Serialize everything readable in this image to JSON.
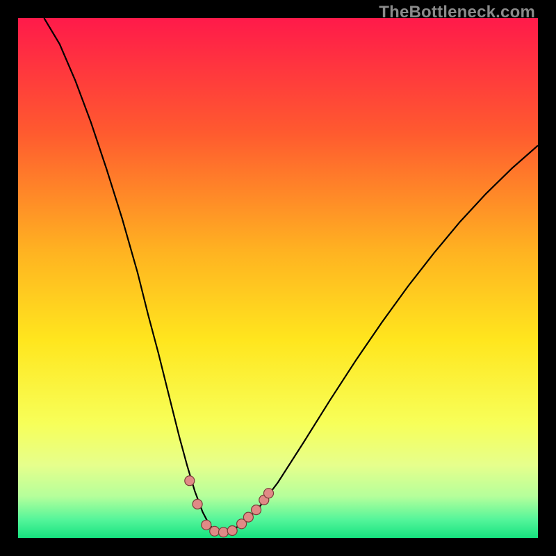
{
  "watermark": "TheBottleneck.com",
  "chart_data": {
    "type": "line",
    "title": "",
    "xlabel": "",
    "ylabel": "",
    "xlim": [
      0,
      100
    ],
    "ylim": [
      0,
      100
    ],
    "background_gradient": {
      "stops": [
        {
          "offset": 0.0,
          "color": "#FF1A4A"
        },
        {
          "offset": 0.22,
          "color": "#FF5A2F"
        },
        {
          "offset": 0.45,
          "color": "#FFB321"
        },
        {
          "offset": 0.62,
          "color": "#FFE61E"
        },
        {
          "offset": 0.78,
          "color": "#F7FF59"
        },
        {
          "offset": 0.86,
          "color": "#E6FF8C"
        },
        {
          "offset": 0.92,
          "color": "#B5FF9B"
        },
        {
          "offset": 0.965,
          "color": "#54F59A"
        },
        {
          "offset": 1.0,
          "color": "#16E27F"
        }
      ]
    },
    "series": [
      {
        "name": "bottleneck-curve",
        "color": "#000000",
        "stroke_width": 2.2,
        "x": [
          5,
          8,
          11,
          14,
          17,
          20,
          23,
          25,
          27,
          29,
          31,
          32.5,
          34,
          35.5,
          36.8,
          38,
          39,
          41,
          43,
          46,
          50,
          55,
          60,
          65,
          70,
          75,
          80,
          85,
          90,
          95,
          100
        ],
        "y": [
          100,
          95,
          88,
          80,
          71,
          61.5,
          51,
          43,
          35.5,
          27.5,
          19.5,
          14,
          9,
          5,
          2.5,
          1.2,
          1,
          1.3,
          2.7,
          5.4,
          10.7,
          18.5,
          26.5,
          34.2,
          41.5,
          48.4,
          54.8,
          60.8,
          66.2,
          71.1,
          75.5
        ]
      }
    ],
    "markers": [
      {
        "x": 33.0,
        "y": 11.0,
        "r": 7,
        "fill": "#e08a86",
        "stroke": "#7a3b38"
      },
      {
        "x": 34.5,
        "y": 6.5,
        "r": 7,
        "fill": "#e08a86",
        "stroke": "#7a3b38"
      },
      {
        "x": 36.2,
        "y": 2.5,
        "r": 7,
        "fill": "#e08a86",
        "stroke": "#7a3b38"
      },
      {
        "x": 37.8,
        "y": 1.3,
        "r": 7,
        "fill": "#e08a86",
        "stroke": "#7a3b38"
      },
      {
        "x": 39.5,
        "y": 1.1,
        "r": 7,
        "fill": "#e08a86",
        "stroke": "#7a3b38"
      },
      {
        "x": 41.2,
        "y": 1.4,
        "r": 7,
        "fill": "#e08a86",
        "stroke": "#7a3b38"
      },
      {
        "x": 43.0,
        "y": 2.7,
        "r": 7,
        "fill": "#e08a86",
        "stroke": "#7a3b38"
      },
      {
        "x": 44.3,
        "y": 4.0,
        "r": 7,
        "fill": "#e08a86",
        "stroke": "#7a3b38"
      },
      {
        "x": 45.8,
        "y": 5.4,
        "r": 7,
        "fill": "#e08a86",
        "stroke": "#7a3b38"
      },
      {
        "x": 47.3,
        "y": 7.3,
        "r": 7,
        "fill": "#e08a86",
        "stroke": "#7a3b38"
      },
      {
        "x": 48.2,
        "y": 8.6,
        "r": 7,
        "fill": "#e08a86",
        "stroke": "#7a3b38"
      }
    ]
  }
}
